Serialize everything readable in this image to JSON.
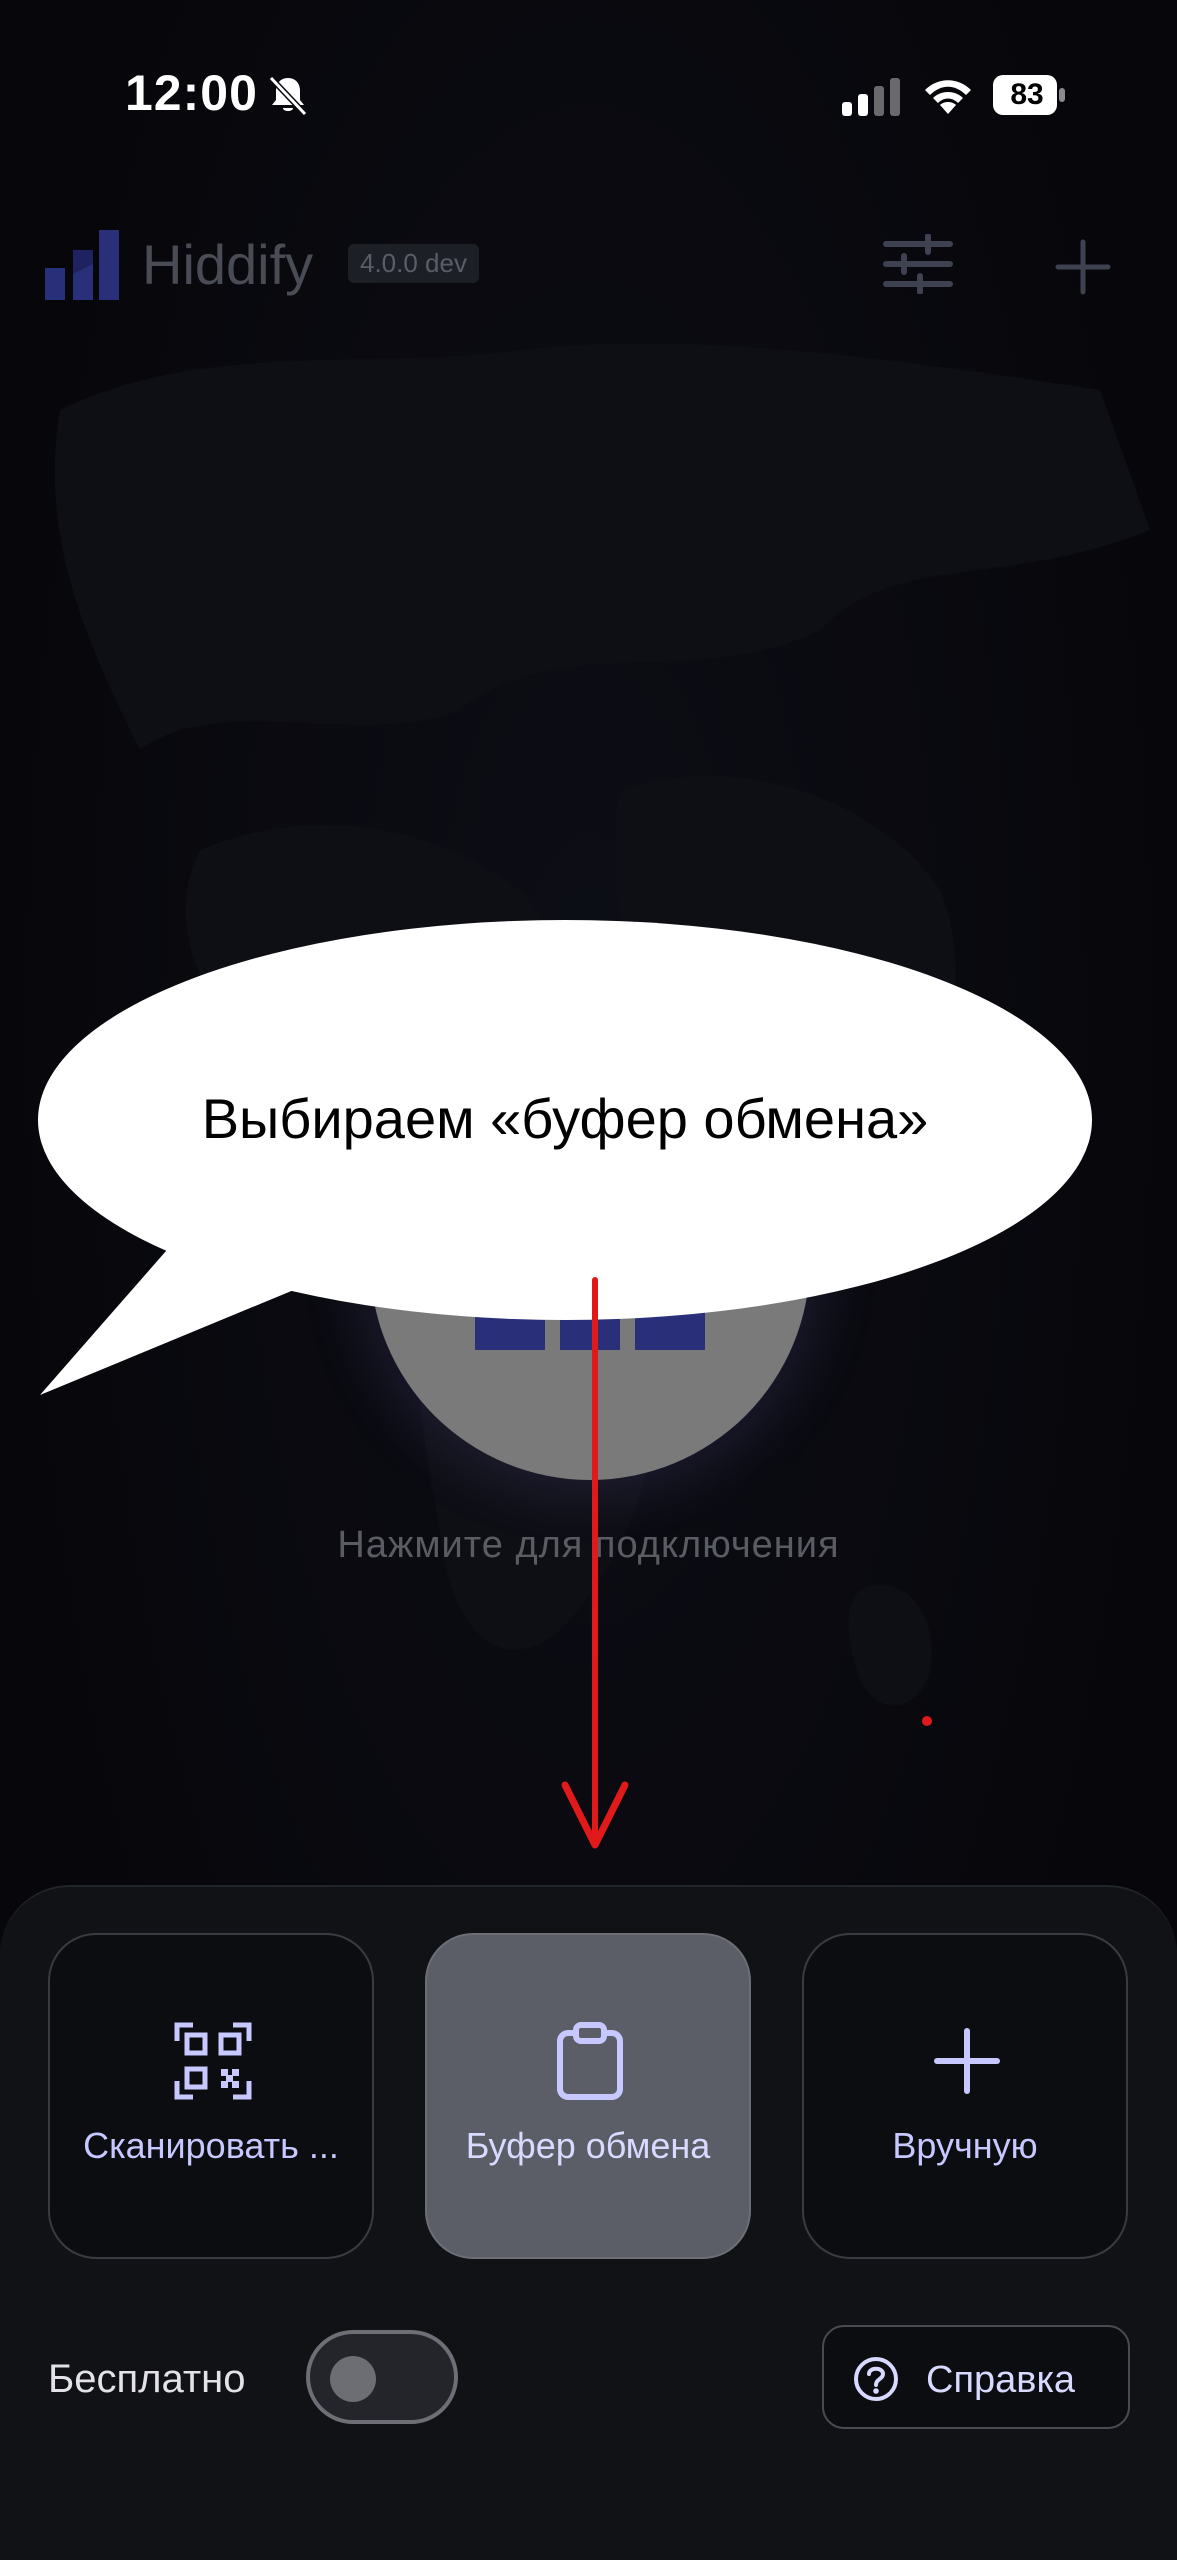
{
  "status_bar": {
    "time": "12:00",
    "battery": "83"
  },
  "header": {
    "app_name": "Hiddify",
    "version": "4.0.0 dev"
  },
  "main": {
    "connect_hint": "Нажмите для подключения"
  },
  "annotation": {
    "bubble_text": "Выбираем «буфер обмена»",
    "arrow_color": "#e01a1a"
  },
  "sheet": {
    "options": [
      {
        "label": "Сканировать ...",
        "icon": "qr-scan-icon"
      },
      {
        "label": "Буфер обмена",
        "icon": "clipboard-icon"
      },
      {
        "label": "Вручную",
        "icon": "plus-icon"
      }
    ],
    "free_label": "Бесплатно",
    "free_toggle_on": false,
    "help_label": "Справка"
  },
  "colors": {
    "accent": "#c6c8ff",
    "background": "#08080d",
    "sheet": "#111216",
    "active_card": "#5b5e66"
  }
}
